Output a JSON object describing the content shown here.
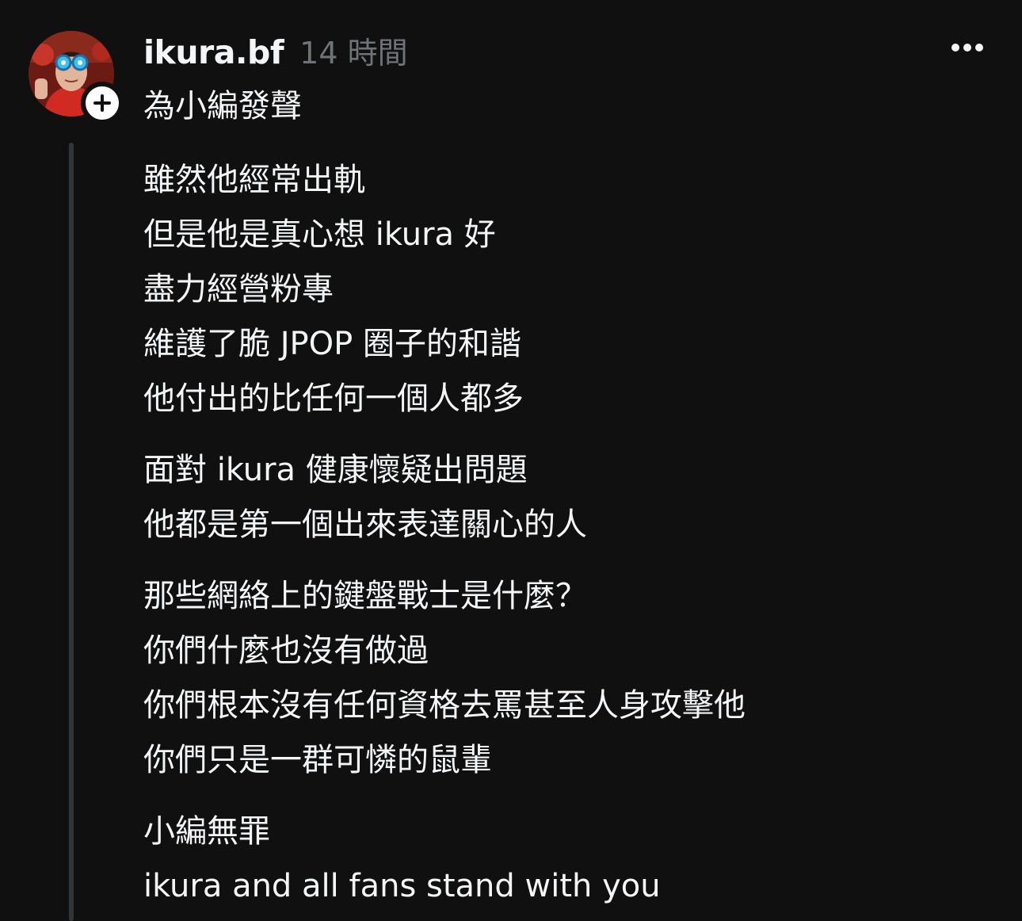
{
  "post": {
    "username": "ikura.bf",
    "timestamp": "14 時間",
    "paragraphs": [
      {
        "lines": [
          "為小編發聲"
        ]
      },
      {
        "lines": [
          "雖然他經常出軌",
          "但是他是真心想 ikura 好",
          "盡力經營粉專",
          "維護了脆 JPOP 圈子的和諧",
          "他付出的比任何一個人都多"
        ]
      },
      {
        "lines": [
          "面對 ikura 健康懷疑出問題",
          "他都是第一個出來表達關心的人"
        ]
      },
      {
        "lines": [
          "那些網絡上的鍵盤戰士是什麼？",
          "你們什麼也沒有做過",
          "你們根本沒有任何資格去罵甚至人身攻擊他",
          "你們只是一群可憐的鼠輩"
        ]
      },
      {
        "lines": [
          "小編無罪",
          "ikura and all fans stand with you"
        ]
      }
    ]
  },
  "icons": {
    "avatar": "avatar-image",
    "follow": "plus-icon",
    "more": "more-horizontal-icon"
  },
  "colors": {
    "background": "#101010",
    "text": "#f3f5f7",
    "muted": "#6f7378",
    "thread_line": "#333638"
  }
}
